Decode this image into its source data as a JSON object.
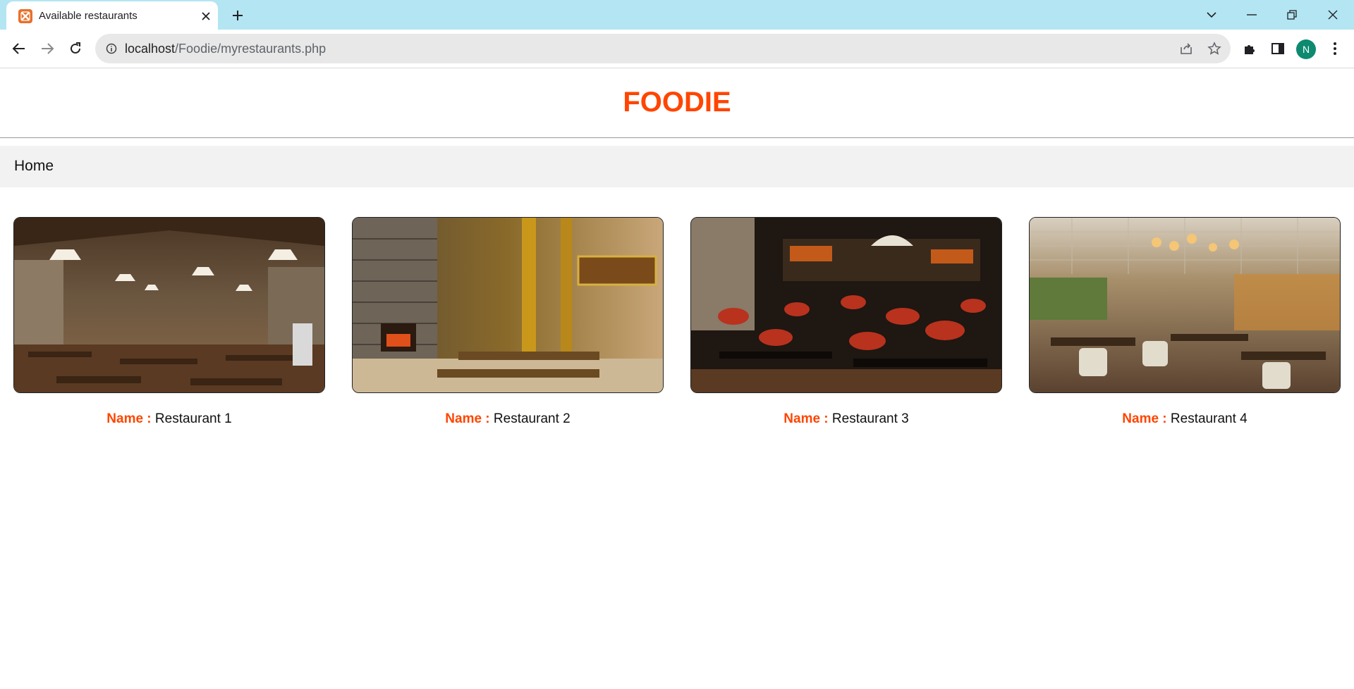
{
  "browser": {
    "tab_title": "Available restaurants",
    "url_host": "localhost",
    "url_path": "/Foodie/myrestaurants.php",
    "profile_initial": "N"
  },
  "site": {
    "brand": "FOODIE",
    "brand_color": "#ff4500",
    "nav_home": "Home",
    "name_label": "Name : "
  },
  "restaurants": [
    {
      "name": "Restaurant 1"
    },
    {
      "name": "Restaurant 2"
    },
    {
      "name": "Restaurant 3"
    },
    {
      "name": "Restaurant 4"
    }
  ]
}
